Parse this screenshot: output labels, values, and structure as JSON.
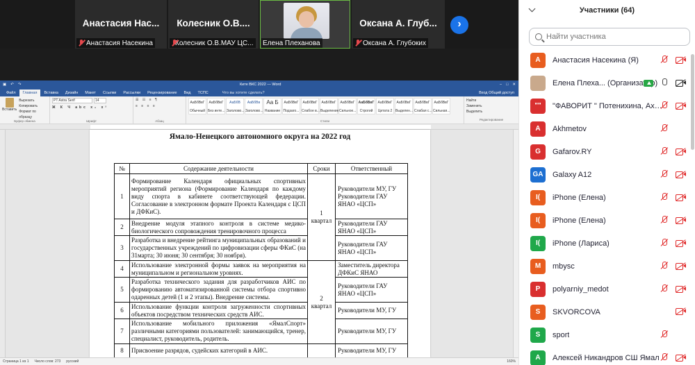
{
  "video_strip": {
    "tiles": [
      {
        "big_name": "Анастасия Нас...",
        "caption": "Анастасия Насекина"
      },
      {
        "big_name": "Колесник О.В....",
        "caption": "Колесник О.В.МАУ ЦС..."
      },
      {
        "big_name": "",
        "caption": "Елена Плеханова"
      },
      {
        "big_name": "Оксана А. Глуб...",
        "caption": "Оксана А. Глубоких"
      }
    ],
    "next_arrow": "›"
  },
  "word": {
    "window_title": "Ките ВКС 2022 — Word",
    "tabs": [
      "Файл",
      "Главная",
      "Вставка",
      "Дизайн",
      "Макет",
      "Ссылки",
      "Рассылки",
      "Рецензирование",
      "Вид",
      "ТСПС"
    ],
    "tell_me": "Что вы хотите сделать?",
    "right_tabs": "Вход   Общий доступ",
    "ribbon": {
      "paste": "Вставить",
      "clipboard_items": [
        "Вырезать",
        "Копировать",
        "Формат по образцу"
      ],
      "clipboard_label": "Буфер обмена",
      "font_name": "PT Astra Serif",
      "font_size": "14",
      "font_label": "Шрифт",
      "paragraph_label": "Абзац",
      "styles": [
        "АаБбВвГ",
        "АаБбВвГ",
        "АаБбВ",
        "АаБбВв",
        "Аа Б",
        "АаБбВвГ",
        "АаБбВвГ",
        "АаБбВвГ",
        "АаБбВвГ",
        "АаБбВвГ",
        "АаБбВвГ",
        "АаБбВвГ",
        "АаБбВвГ",
        "АаБбВвГ"
      ],
      "style_names": [
        "Обычный",
        "Без инте...",
        "Заголово...",
        "Заголово...",
        "Название",
        "Подзаго...",
        "Слабое в...",
        "Выделение",
        "Сильное...",
        "Строгий",
        "Цитата 2",
        "Выделен...",
        "Слабая с...",
        "Сильная..."
      ],
      "styles_label": "Стили",
      "edit_items": [
        "Найти",
        "Заменить",
        "Выделить"
      ],
      "edit_label": "Редактирование"
    },
    "status": {
      "page": "Страница 1 из 1",
      "words": "Число слов: 273",
      "lang": "русский",
      "zoom": "160%"
    },
    "doc": {
      "heading": "Ямало-Ненецкого автономного округа на 2022 год",
      "headers": [
        "№",
        "Содержание деятельности",
        "Сроки",
        "Ответственный"
      ],
      "rows": [
        {
          "num": "1",
          "content": "Формирование Календаря официальных спортивных мероприятий региона (Формирование Календаря по каждому виду спорта в кабинете соответствующей федерации. Согласование в электронном формате Проекта Календаря с ЦСП и ДФКиС).",
          "resp": "Руководители МУ, ГУ Руководители ГАУ ЯНАО «ЦСП»"
        },
        {
          "num": "2",
          "content": "Внедрение модуля этапного контроля в системе медико-биологического сопровождения тренировочного процесса",
          "resp": "Руководители ГАУ ЯНАО «ЦСП»"
        },
        {
          "num": "3",
          "content": "Разработка и внедрение рейтинга муниципальных образований и государственных учреждений по цифровизации сферы ФКиС (на 31марта; 30 июня; 30 сентября; 30 ноября).",
          "resp": "Руководители ГАУ ЯНАО «ЦСП»"
        },
        {
          "num": "4",
          "content": "Использование электронной формы заявок на мероприятия на муниципальном и региональном уровнях.",
          "resp": "Заместитель директора ДФКиС ЯНАО"
        },
        {
          "num": "5",
          "content": "Разработка технического задания для разработчиков АИС по формированию автоматизированной системы отбора спортивно одаренных детей (1 и 2 этапы). Внедрение системы.",
          "resp": "Руководители ГАУ ЯНАО «ЦСП»"
        },
        {
          "num": "6",
          "content": "Использование функции контроля загруженности спортивных объектов посредством технических средств АИС.",
          "resp": "Руководители МУ, ГУ"
        },
        {
          "num": "7",
          "content": "Использование мобильного приложения «ЯмалСпорт» различными категориями пользователей: занимающийся, тренер, специалист, руководитель, родитель.",
          "resp": "Руководители МУ, ГУ"
        },
        {
          "num": "8",
          "content": "Присвоение разрядов, судейских категорий в АИС.",
          "resp": "Руководители МУ, ГУ"
        }
      ],
      "terms": [
        {
          "num": "1",
          "label": "квартал"
        },
        {
          "num": "2",
          "label": "квартал"
        }
      ]
    }
  },
  "panel": {
    "title": "Участники (64)",
    "search_placeholder": "Найти участника",
    "participants": [
      {
        "initials": "А",
        "color": "#e85d1f",
        "name": "Анастасия Насекина (Я)",
        "mic": "off",
        "video": "off"
      },
      {
        "initials": "",
        "color": "#c9a98c",
        "name": "Елена Плеха...  (Организатор)",
        "mic": "on",
        "video": "on",
        "share": true
      },
      {
        "initials": "\"\"",
        "color": "#d92f2f",
        "name": "\"ФАВОРИТ \" Потенихина, Ахметов, ...",
        "mic": "off",
        "video": "off"
      },
      {
        "initials": "A",
        "color": "#d92f2f",
        "name": "Akhmetov",
        "mic": "off",
        "video": "none"
      },
      {
        "initials": "G",
        "color": "#d92f2f",
        "name": "Gafarov.RY",
        "mic": "off",
        "video": "off"
      },
      {
        "initials": "GA",
        "color": "#1d6fd1",
        "name": "Galaxy A12",
        "mic": "off",
        "video": "off"
      },
      {
        "initials": "I(",
        "color": "#e85d1f",
        "name": "iPhone (Елена)",
        "mic": "off",
        "video": "off"
      },
      {
        "initials": "I(",
        "color": "#e85d1f",
        "name": "iPhone (Елена)",
        "mic": "off",
        "video": "off"
      },
      {
        "initials": "I(",
        "color": "#1fa84a",
        "name": "iPhone (Лариса)",
        "mic": "off",
        "video": "off"
      },
      {
        "initials": "M",
        "color": "#e85d1f",
        "name": "mbysc",
        "mic": "off",
        "video": "off"
      },
      {
        "initials": "P",
        "color": "#d92f2f",
        "name": "polyarniy_medot",
        "mic": "off",
        "video": "off"
      },
      {
        "initials": "S",
        "color": "#e85d1f",
        "name": "SKVORCOVA",
        "mic": "none",
        "video": "off"
      },
      {
        "initials": "S",
        "color": "#1fa84a",
        "name": "sport",
        "mic": "off",
        "video": "none"
      },
      {
        "initials": "А",
        "color": "#1fa84a",
        "name": "Алексей Никандров СШ Ямал",
        "mic": "off",
        "video": "off"
      }
    ]
  }
}
